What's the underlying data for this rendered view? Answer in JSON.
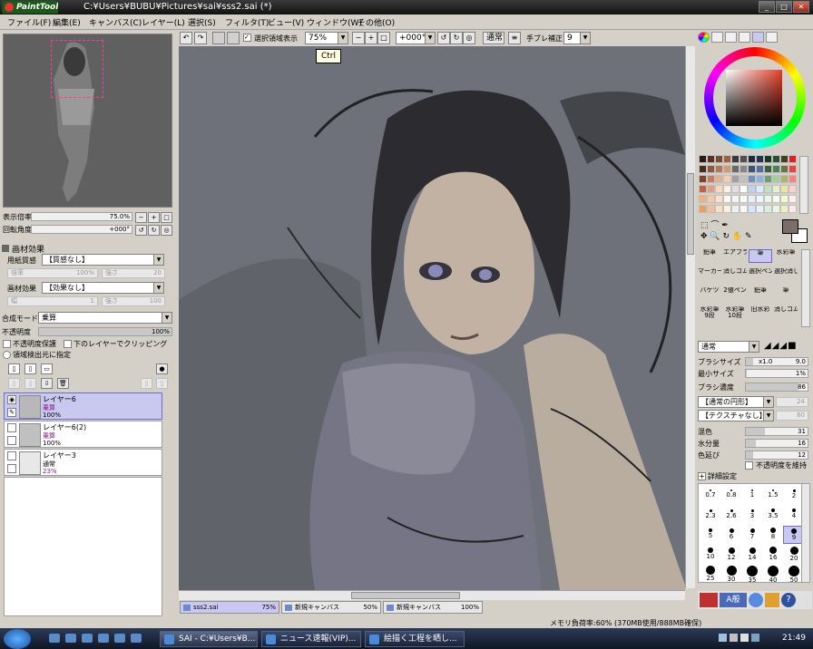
{
  "window": {
    "app_logo": "PaintTool SAI",
    "title": "C:¥Users¥BUBU¥Pictures¥sai¥sss2.sai (*)"
  },
  "menu": [
    "ファイル(F)",
    "編集(E)",
    "キャンバス(C)",
    "レイヤー(L)",
    "選択(S)",
    "フィルタ(T)",
    "ビュー(V)",
    "ウィンドウ(W)",
    "その他(O)"
  ],
  "toolbar": {
    "selection_display_label": "選択領域表示",
    "zoom": "75%",
    "rotation": "+000°",
    "blend": "通常",
    "stabilizer_label": "手ブレ補正",
    "stabilizer_value": "9",
    "tooltip": "Ctrl"
  },
  "navigator": {
    "zoom_label": "表示倍率",
    "zoom_value": "75.0%",
    "rotation_label": "回転角度",
    "rotation_value": "+000°"
  },
  "paper_effects": {
    "header": "画材効果",
    "texture_label": "用紙質感",
    "texture_value": "【質感なし】",
    "scale_label": "倍率",
    "scale_value": "100%",
    "strength_label": "強さ",
    "strength_value": "20",
    "effect_label": "画材効果",
    "effect_value": "【効果なし】",
    "width_label": "幅",
    "width_value": "1",
    "strength2_label": "強さ",
    "strength2_value": "100"
  },
  "layer_props": {
    "blend_label": "合成モード",
    "blend_value": "乗算",
    "opacity_label": "不透明度",
    "opacity_value": "100%",
    "preserve_opacity": "不透明度保護",
    "clip_group": "下のレイヤーでクリッピング",
    "selection_source": "領域検出元に指定"
  },
  "layers": [
    {
      "name": "レイヤー6",
      "mode": "乗算",
      "opacity": "100%",
      "selected": true
    },
    {
      "name": "レイヤー6(2)",
      "mode": "乗算",
      "opacity": "100%",
      "selected": false
    },
    {
      "name": "レイヤー3",
      "mode": "通常",
      "opacity": "23%",
      "selected": false
    }
  ],
  "canvas_tabs": [
    {
      "name": "sss2.sai",
      "zoom": "75%"
    },
    {
      "name": "新規キャンバス",
      "zoom": "50%"
    },
    {
      "name": "新規キャンバス",
      "zoom": "100%"
    }
  ],
  "status": {
    "memory": "メモリ負荷率:60% (370MB使用/888MB確保)"
  },
  "tools": [
    [
      "鉛筆",
      "エアブラシ",
      "筆",
      "水彩筆"
    ],
    [
      "マーカー",
      "消しゴム",
      "選択ペン",
      "選択消し"
    ],
    [
      "バケツ",
      "2値ペン",
      "鉛筆",
      "筆"
    ],
    [
      "水彩筆",
      "水彩筆",
      "旧水彩",
      "消しゴム"
    ]
  ],
  "tools_sub": [
    "",
    "",
    "",
    "",
    "",
    "",
    "",
    "",
    "",
    "",
    "",
    "",
    "9段",
    "10段",
    "",
    ""
  ],
  "brush": {
    "mode": "通常",
    "size_label": "ブラシサイズ",
    "size_mult": "x1.0",
    "size_value": "9.0",
    "min_size_label": "最小サイズ",
    "min_size_value": "1%",
    "density_label": "ブラシ濃度",
    "density_value": "86",
    "shape_value": "【通常の円形】",
    "shape_strength": "24",
    "texture_value": "【テクスチャなし】",
    "texture_strength": "60",
    "blend_label": "混色",
    "blend_value": "31",
    "water_label": "水分量",
    "water_value": "16",
    "color_extend_label": "色延び",
    "color_extend_value": "12",
    "keep_opacity": "不透明度を維持",
    "detail_label": "詳細設定"
  },
  "brush_sizes": [
    "0.7",
    "0.8",
    "1",
    "1.5",
    "2",
    "2.3",
    "2.6",
    "3",
    "3.5",
    "4",
    "5",
    "6",
    "7",
    "8",
    "9",
    "10",
    "12",
    "14",
    "16",
    "20",
    "25",
    "30",
    "35",
    "40",
    "50"
  ],
  "taskbar": {
    "tasks": [
      "SAI - C:¥Users¥B...",
      "ニュース速報(VIP)...",
      "絵描く工程を晒し..."
    ],
    "clock": "21:49"
  },
  "colors": {
    "accent": "#c8c8f0",
    "canvas_bg": "#6e707a",
    "foreground": "#7a6d6a"
  }
}
